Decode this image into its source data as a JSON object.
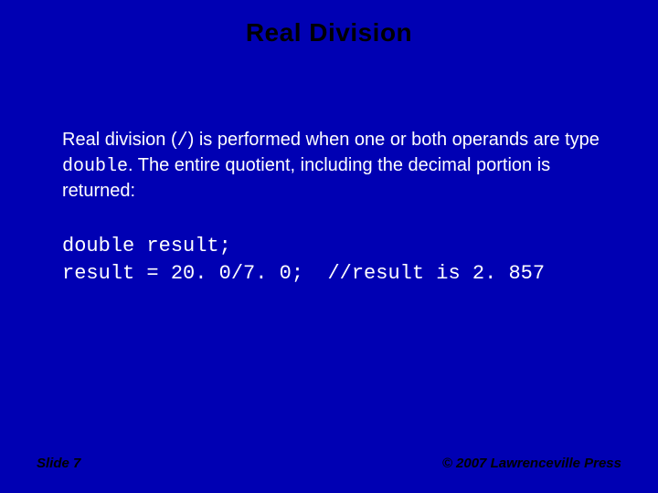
{
  "title": "Real Division",
  "paragraph": {
    "part1": "Real division (",
    "slash": "/",
    "part2": ") is performed when one or both operands are type ",
    "double_word": "double",
    "part3": ". The entire quotient, including the decimal portion is returned:"
  },
  "code": "double result;\nresult = 20. 0/7. 0;  //result is 2. 857",
  "footer": {
    "slide": "Slide 7",
    "copyright": "© 2007 Lawrenceville Press"
  }
}
